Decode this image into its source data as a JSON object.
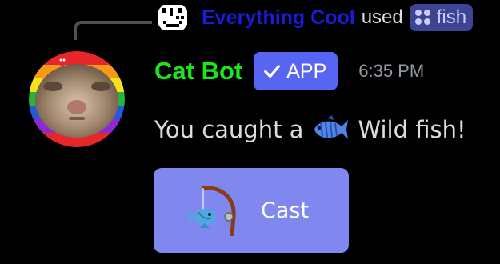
{
  "reply": {
    "user_name": "Everything Cool",
    "used_text": "used",
    "command_name": "fish"
  },
  "message": {
    "author": "Cat Bot",
    "badge": "APP",
    "timestamp": "6:35 PM",
    "text_prefix": "You caught a",
    "text_suffix": "Wild fish!"
  },
  "button": {
    "label": "Cast"
  },
  "colors": {
    "reply_name": "#1b1bd8",
    "author_name": "#1ae61a",
    "app_badge": "#5865f2",
    "command_pill": "#3c4493",
    "cast_button": "#8088f0",
    "background": "#000000"
  },
  "icons": {
    "reply_avatar": "pixel-smiley-icon",
    "command": "command-icon",
    "badge": "check-icon",
    "fish": "fish-icon",
    "rod": "fishing-rod-icon"
  }
}
